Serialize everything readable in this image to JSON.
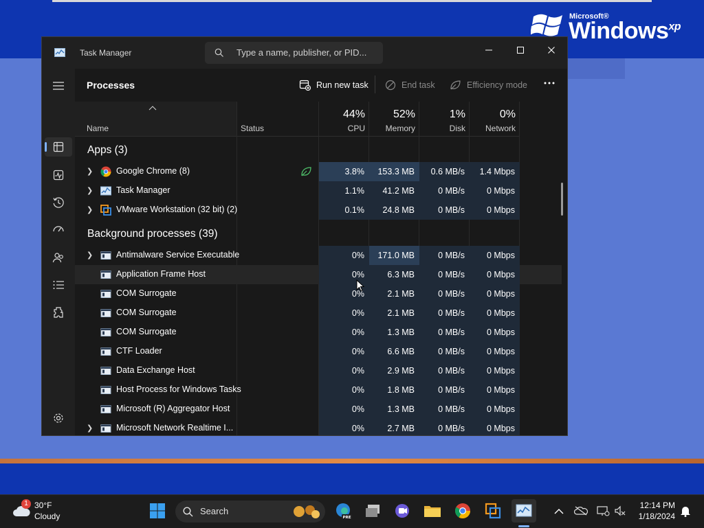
{
  "desktop": {
    "logo": {
      "microsoft": "Microsoft®",
      "windows": "Windows",
      "xp": "xp"
    }
  },
  "window": {
    "title": "Task Manager",
    "search_placeholder": "Type a name, publisher, or PID..."
  },
  "toolbar": {
    "page_title": "Processes",
    "run_new_task": "Run new task",
    "end_task": "End task",
    "efficiency_mode": "Efficiency mode"
  },
  "columns": {
    "name": "Name",
    "status": "Status",
    "cpu_pct": "44%",
    "cpu": "CPU",
    "memory_pct": "52%",
    "memory": "Memory",
    "disk_pct": "1%",
    "disk": "Disk",
    "network_pct": "0%",
    "network": "Network"
  },
  "groups": {
    "apps": "Apps (3)",
    "background": "Background processes (39)"
  },
  "apps": [
    {
      "name": "Google Chrome (8)",
      "cpu": "3.8%",
      "memory": "153.3 MB",
      "disk": "0.6 MB/s",
      "network": "1.4 Mbps",
      "icon": "chrome-icon"
    },
    {
      "name": "Task Manager",
      "cpu": "1.1%",
      "memory": "41.2 MB",
      "disk": "0 MB/s",
      "network": "0 Mbps",
      "icon": "task-manager-icon"
    },
    {
      "name": "VMware Workstation (32 bit) (2)",
      "cpu": "0.1%",
      "memory": "24.8 MB",
      "disk": "0 MB/s",
      "network": "0 Mbps",
      "icon": "vmware-icon"
    }
  ],
  "background": [
    {
      "name": "Antimalware Service Executable",
      "cpu": "0%",
      "memory": "171.0 MB",
      "disk": "0 MB/s",
      "network": "0 Mbps"
    },
    {
      "name": "Application Frame Host",
      "cpu": "0%",
      "memory": "6.3 MB",
      "disk": "0 MB/s",
      "network": "0 Mbps"
    },
    {
      "name": "COM Surrogate",
      "cpu": "0%",
      "memory": "2.1 MB",
      "disk": "0 MB/s",
      "network": "0 Mbps"
    },
    {
      "name": "COM Surrogate",
      "cpu": "0%",
      "memory": "2.1 MB",
      "disk": "0 MB/s",
      "network": "0 Mbps"
    },
    {
      "name": "COM Surrogate",
      "cpu": "0%",
      "memory": "1.3 MB",
      "disk": "0 MB/s",
      "network": "0 Mbps"
    },
    {
      "name": "CTF Loader",
      "cpu": "0%",
      "memory": "6.6 MB",
      "disk": "0 MB/s",
      "network": "0 Mbps"
    },
    {
      "name": "Data Exchange Host",
      "cpu": "0%",
      "memory": "2.9 MB",
      "disk": "0 MB/s",
      "network": "0 Mbps"
    },
    {
      "name": "Host Process for Windows Tasks",
      "cpu": "0%",
      "memory": "1.8 MB",
      "disk": "0 MB/s",
      "network": "0 Mbps"
    },
    {
      "name": "Microsoft (R) Aggregator Host",
      "cpu": "0%",
      "memory": "1.3 MB",
      "disk": "0 MB/s",
      "network": "0 Mbps"
    },
    {
      "name": "Microsoft Network Realtime I...",
      "cpu": "0%",
      "memory": "2.7 MB",
      "disk": "0 MB/s",
      "network": "0 Mbps"
    }
  ],
  "taskbar": {
    "weather_temp": "30°F",
    "weather_desc": "Cloudy",
    "weather_badge": "1",
    "search_label": "Search",
    "time": "12:14 PM",
    "date": "1/18/2024"
  },
  "colors": {
    "accent": "#7fb2ff",
    "heat_high": "#2b3f57",
    "heat_low": "#1f2a38"
  }
}
